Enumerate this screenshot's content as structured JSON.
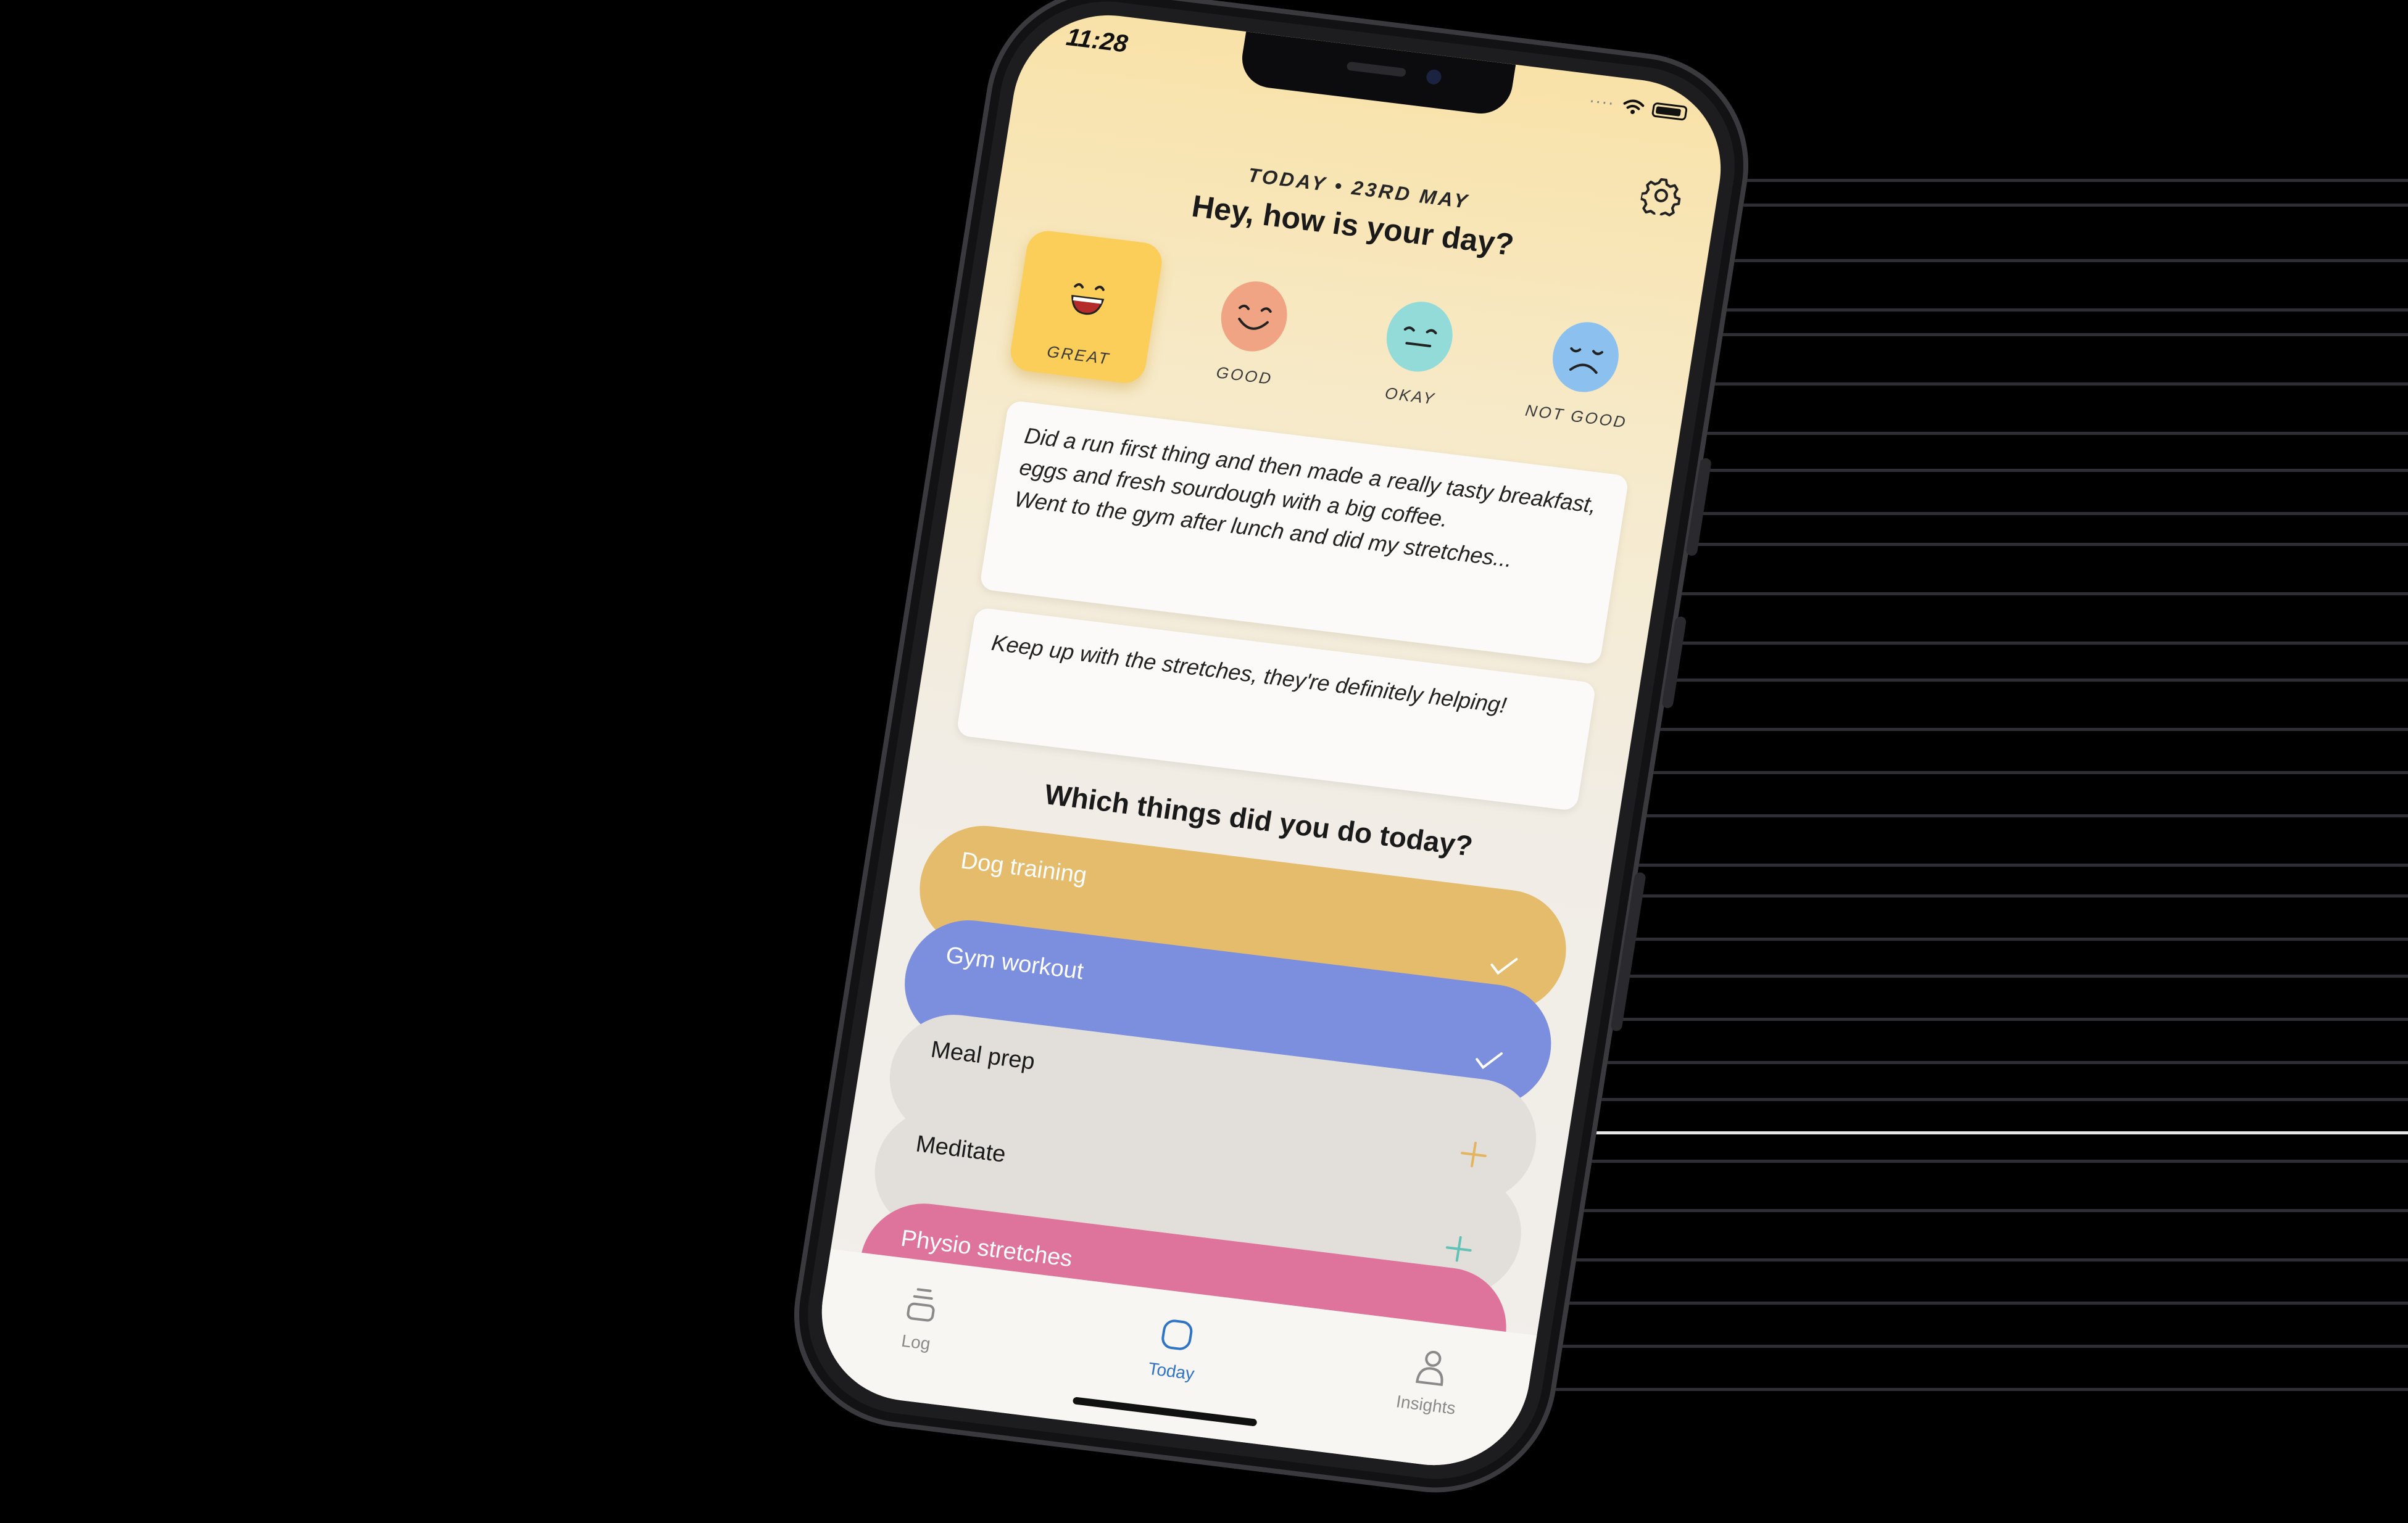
{
  "status_bar": {
    "time": "11:28",
    "signal": "····"
  },
  "header": {
    "date": "TODAY • 23RD MAY",
    "question": "Hey, how is your day?"
  },
  "moods": [
    {
      "label": "GREAT",
      "color": "#fbcd59",
      "selected": true
    },
    {
      "label": "GOOD",
      "color": "#f0a483",
      "selected": false
    },
    {
      "label": "OKAY",
      "color": "#93dbd8",
      "selected": false
    },
    {
      "label": "NOT GOOD",
      "color": "#8cc0ef",
      "selected": false
    }
  ],
  "journal": {
    "line1": "Did a run first thing and then made a really tasty breakfast, eggs and fresh sourdough with a big coffee.",
    "line2": "Went to the gym after lunch and did my stretches..."
  },
  "tip": {
    "text": "Keep up with the stretches, they're definitely helping!"
  },
  "activities": {
    "title": "Which things did you do today?",
    "items": [
      {
        "name": "Dog training",
        "done": true,
        "color": "#e5bb6c",
        "text_color": "#ffffff"
      },
      {
        "name": "Gym workout",
        "done": true,
        "color": "#7c8ede",
        "text_color": "#ffffff"
      },
      {
        "name": "Meal prep",
        "done": false,
        "color": "#e2dfda",
        "text_color": "#1a1a1a",
        "mark_color": "#e3b560"
      },
      {
        "name": "Meditate",
        "done": false,
        "color": "#e2dfda",
        "text_color": "#1a1a1a",
        "mark_color": "#63c1b6"
      },
      {
        "name": "Physio stretches",
        "done": true,
        "color": "#de749b",
        "text_color": "#ffffff"
      }
    ]
  },
  "tabbar": {
    "log": "Log",
    "today": "Today",
    "insights": "Insights",
    "active_color": "#2f74c5",
    "inactive_color": "#8a8a8a"
  }
}
